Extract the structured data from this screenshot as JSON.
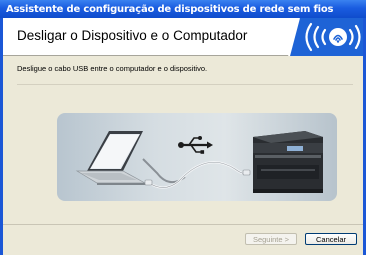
{
  "window": {
    "title": "Assistente de configuração de dispositivos de rede sem fios"
  },
  "header": {
    "title": "Desligar o Dispositivo e o Computador",
    "logo_icon": "wireless-icon"
  },
  "main": {
    "instruction": "Desligue o cabo USB entre o computador e o dispositivo.",
    "illustration": {
      "icons": [
        "laptop-icon",
        "usb-icon",
        "printer-icon"
      ]
    }
  },
  "footer": {
    "next_label": "Seguinte >",
    "cancel_label": "Cancelar"
  },
  "colors": {
    "titlebar": "#1a5ce0",
    "client_background": "#ece9d8",
    "logo_blue": "#1e63d6"
  }
}
